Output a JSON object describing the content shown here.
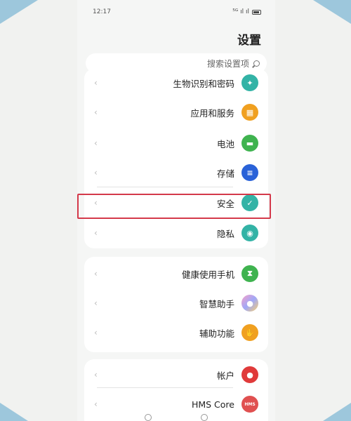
{
  "statusbar": {
    "time": "12:17",
    "signal_text": "⁵ᴳ ıl ıl"
  },
  "page": {
    "title": "设置"
  },
  "search": {
    "placeholder": "搜索设置项"
  },
  "groups": [
    {
      "items": [
        {
          "label": "生物识别和密码",
          "icon": "key-icon",
          "color": "#33b3a6",
          "glyph": "✦"
        },
        {
          "label": "应用和服务",
          "icon": "apps-icon",
          "color": "#f0a020",
          "glyph": "▦"
        },
        {
          "label": "电池",
          "icon": "battery-icon",
          "color": "#3fb34f",
          "glyph": "▬"
        },
        {
          "label": "存储",
          "icon": "storage-icon",
          "color": "#2a62d8",
          "glyph": "≡"
        },
        {
          "label": "安全",
          "icon": "shield-icon",
          "color": "#33b3a6",
          "glyph": "✓"
        },
        {
          "label": "隐私",
          "icon": "privacy-icon",
          "color": "#33b3a6",
          "glyph": "◉"
        }
      ]
    },
    {
      "items": [
        {
          "label": "健康使用手机",
          "icon": "hourglass-icon",
          "color": "#3fb34f",
          "glyph": "⧗"
        },
        {
          "label": "智慧助手",
          "icon": "assistant-icon",
          "color": "#b48cf0",
          "glyph": "●"
        },
        {
          "label": "辅助功能",
          "icon": "hand-icon",
          "color": "#f0a020",
          "glyph": "✋"
        }
      ]
    },
    {
      "items": [
        {
          "label": "帐户",
          "icon": "account-icon",
          "color": "#e03a3a",
          "glyph": "●"
        },
        {
          "label": "HMS Core",
          "icon": "hms-icon",
          "color": "#e05050",
          "glyph": "HMS"
        }
      ]
    }
  ],
  "colors": {
    "highlight": "#d4394a",
    "background": "#f1f2f0"
  }
}
